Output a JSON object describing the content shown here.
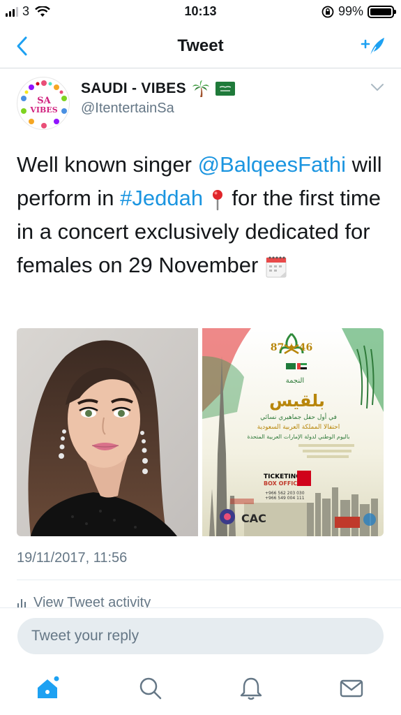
{
  "status_bar": {
    "carrier": "3",
    "time": "10:13",
    "battery_percent": "99%",
    "battery_level": 0.99,
    "signal_bars_active": 3,
    "signal_bars_total": 4
  },
  "nav": {
    "title": "Tweet"
  },
  "tweet": {
    "author_name": "SAUDI - VIBES",
    "author_emojis": [
      "palm-tree",
      "saudi-flag"
    ],
    "handle": "@ItentertainSa",
    "avatar_text_top": "SA",
    "avatar_text_bottom": "VIBES",
    "text_parts": {
      "p1": "Well known singer ",
      "mention": "@BalqeesFathi",
      "p2": " will perform in ",
      "hashtag": "#Jeddah",
      "p3": " for the first time in a concert exclusively dedicated for females on 29 November "
    },
    "emojis_inline": [
      "round-pushpin",
      "spiral-calendar"
    ],
    "media": {
      "left_image": "portrait-photo",
      "right_image": "concert-poster",
      "poster_texts": {
        "arabic_name": "بلقيس",
        "star": "النجمة",
        "line1": "في أول حفل جماهيري نسائي",
        "line2": "احتفالا المملكة العربية السعودية",
        "line3": "باليوم الوطني لدولة الإمارات العربية المتحدة",
        "ticketing": "TICKETING",
        "box_office": "BOX OFFICE",
        "phone1": "+966 562 203 030",
        "phone2": "+966 549 004 111"
      }
    },
    "timestamp": "19/11/2017, 11:56",
    "activity_label": "View Tweet activity"
  },
  "reply": {
    "placeholder": "Tweet your reply"
  },
  "tabs": [
    {
      "name": "home",
      "icon": "home-icon",
      "active": true
    },
    {
      "name": "search",
      "icon": "search-icon",
      "active": false
    },
    {
      "name": "notifications",
      "icon": "bell-icon",
      "active": false
    },
    {
      "name": "messages",
      "icon": "mail-icon",
      "active": false
    }
  ],
  "colors": {
    "accent": "#1da1f2",
    "link": "#1b95e0",
    "muted": "#657786",
    "reply_bg": "#e6ecf0"
  }
}
